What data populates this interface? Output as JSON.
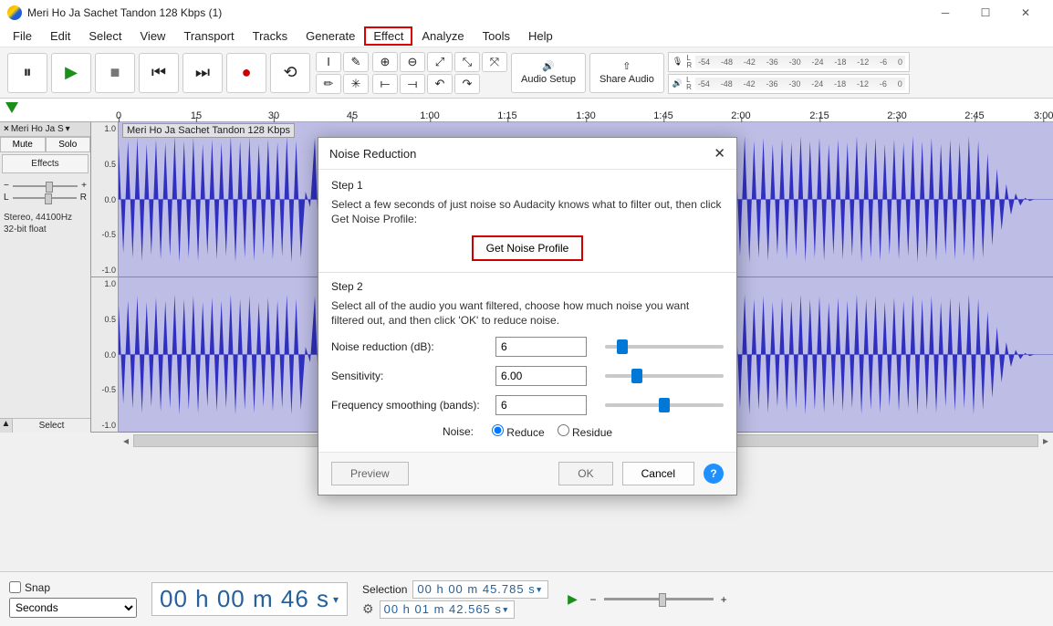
{
  "title": "Meri Ho Ja Sachet Tandon 128 Kbps (1)",
  "menu": [
    "File",
    "Edit",
    "Select",
    "View",
    "Transport",
    "Tracks",
    "Generate",
    "Effect",
    "Analyze",
    "Tools",
    "Help"
  ],
  "menu_highlight_index": 7,
  "toolbar": {
    "audio_setup": "Audio Setup",
    "share_audio": "Share Audio"
  },
  "meter_ticks": [
    "-54",
    "-48",
    "-42",
    "-36",
    "-30",
    "-24",
    "-18",
    "-12",
    "-6",
    "0"
  ],
  "ruler_ticks": [
    "0",
    "15",
    "30",
    "45",
    "1:00",
    "1:15",
    "1:30",
    "1:45",
    "2:00",
    "2:15",
    "2:30",
    "2:45",
    "3:00"
  ],
  "track": {
    "name": "Meri Ho Ja S",
    "clip_title": "Meri Ho Ja Sachet Tandon 128 Kbps",
    "mute": "Mute",
    "solo": "Solo",
    "effects": "Effects",
    "pan_left": "L",
    "pan_right": "R",
    "info1": "Stereo, 44100Hz",
    "info2": "32-bit float",
    "select": "Select",
    "scale": [
      "1.0",
      "0.5",
      "0.0",
      "-0.5",
      "-1.0"
    ]
  },
  "status": {
    "snap": "Snap",
    "snap_mode": "Seconds",
    "time": "00 h 00 m 46 s",
    "selection_label": "Selection",
    "sel_start": "00 h 00 m 45.785 s",
    "sel_end": "00 h 01 m 42.565 s"
  },
  "dialog": {
    "title": "Noise Reduction",
    "step1": "Step 1",
    "step1_desc": "Select a few seconds of just noise so Audacity knows what to filter out, then click Get Noise Profile:",
    "profile_btn": "Get Noise Profile",
    "step2": "Step 2",
    "step2_desc": "Select all of the audio you want filtered, choose how much noise you want filtered out, and then click 'OK' to reduce noise.",
    "nr_label": "Noise reduction (dB):",
    "nr_val": "6",
    "sens_label": "Sensitivity:",
    "sens_val": "6.00",
    "freq_label": "Frequency smoothing (bands):",
    "freq_val": "6",
    "noise_label": "Noise:",
    "reduce": "Reduce",
    "residue": "Residue",
    "preview": "Preview",
    "ok": "OK",
    "cancel": "Cancel"
  }
}
